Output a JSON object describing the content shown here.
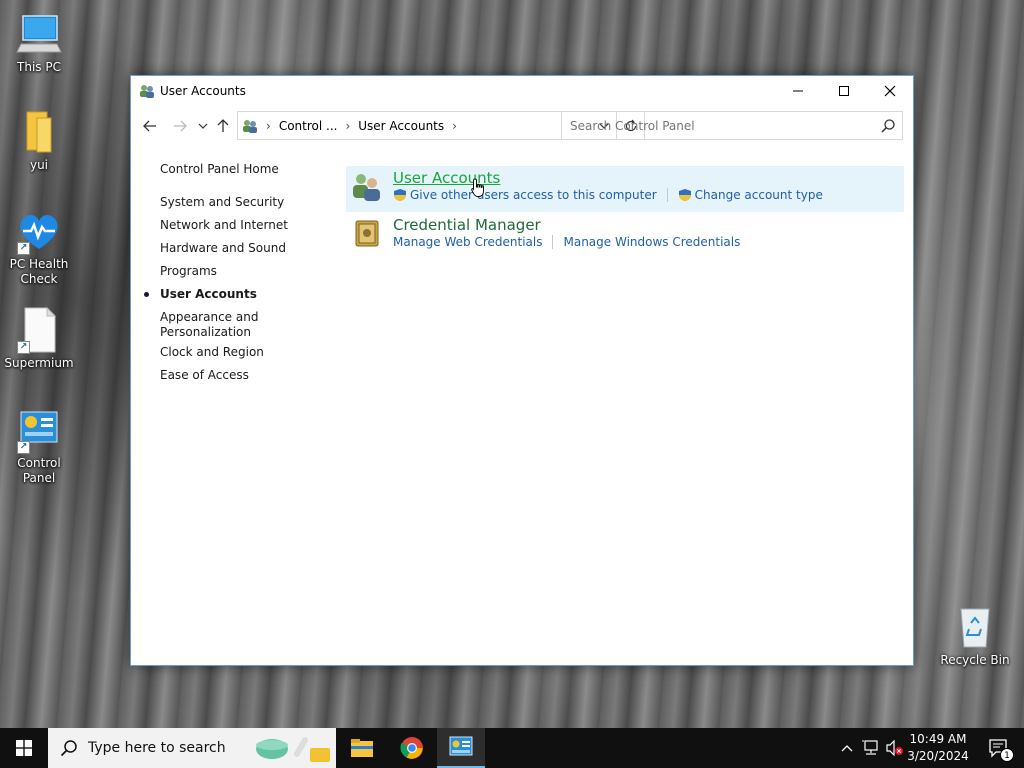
{
  "desktop": {
    "icons": [
      {
        "label": "This PC"
      },
      {
        "label": "yui"
      },
      {
        "label": "PC Health Check"
      },
      {
        "label": "Supermium"
      },
      {
        "label": "Control Panel"
      },
      {
        "label": "Recycle Bin"
      }
    ]
  },
  "window": {
    "title": "User Accounts",
    "address": {
      "crumbs": [
        "Control ...",
        "User Accounts"
      ]
    },
    "search": {
      "placeholder": "Search Control Panel"
    },
    "left_nav": {
      "home": "Control Panel Home",
      "items": [
        "System and Security",
        "Network and Internet",
        "Hardware and Sound",
        "Programs",
        "User Accounts",
        "Appearance and Personalization",
        "Clock and Region",
        "Ease of Access"
      ],
      "active_index": 4
    },
    "categories": [
      {
        "title": "User Accounts",
        "links": [
          "Give other users access to this computer",
          "Change account type"
        ]
      },
      {
        "title": "Credential Manager",
        "links": [
          "Manage Web Credentials",
          "Manage Windows Credentials"
        ]
      }
    ]
  },
  "taskbar": {
    "search_placeholder": "Type here to search",
    "clock": {
      "time": "10:49 AM",
      "date": "3/20/2024"
    },
    "notification_count": "1"
  },
  "colors": {
    "link_blue": "#1f5fa8",
    "category_green": "#1e6b3a",
    "hover_bg": "#e5f3fb",
    "taskbar": "#101010"
  }
}
